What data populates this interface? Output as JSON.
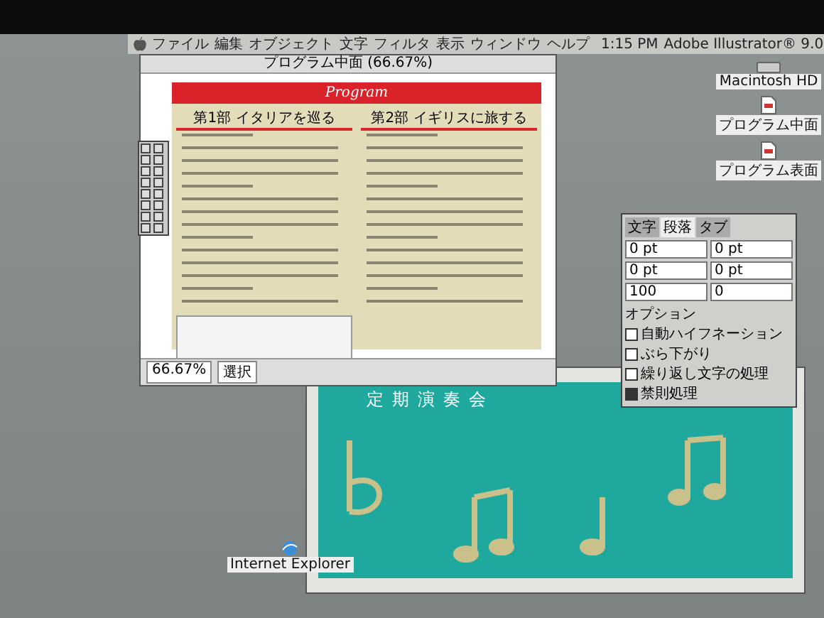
{
  "menubar": {
    "menus": [
      "ファイル",
      "編集",
      "オブジェクト",
      "文字",
      "フィルタ",
      "表示",
      "ウィンドウ",
      "ヘルプ"
    ],
    "clock": "1:15 PM",
    "app": "Adobe Illustrator® 9.0"
  },
  "desktop_icons": [
    {
      "label": "Macintosh HD"
    },
    {
      "label": "プログラム中面"
    },
    {
      "label": "プログラム表面"
    }
  ],
  "document_window": {
    "title": "プログラム中面 (66.67%)",
    "banner": "Program",
    "columns": [
      {
        "heading": "第1部 イタリアを巡る"
      },
      {
        "heading": "第2部 イギリスに旅する"
      }
    ],
    "zoom": "66.67%",
    "status": "選択"
  },
  "back_window": {
    "title": "定期演奏会"
  },
  "text_panel": {
    "tabs": [
      {
        "label": "文字",
        "selected": false
      },
      {
        "label": "段落",
        "selected": true
      },
      {
        "label": "タブ",
        "selected": false
      }
    ],
    "fields": [
      "0 pt",
      "0 pt",
      "0 pt",
      "0 pt"
    ],
    "spacing": [
      "100",
      "0"
    ],
    "section": "オプション",
    "options": [
      {
        "label": "自動ハイフネーション",
        "checked": false
      },
      {
        "label": "ぶら下がり",
        "checked": false
      },
      {
        "label": "繰り返し文字の処理",
        "checked": false
      },
      {
        "label": "禁則処理",
        "checked": true
      }
    ]
  },
  "dock_icons": [
    {
      "label": "Internet Explorer"
    }
  ]
}
